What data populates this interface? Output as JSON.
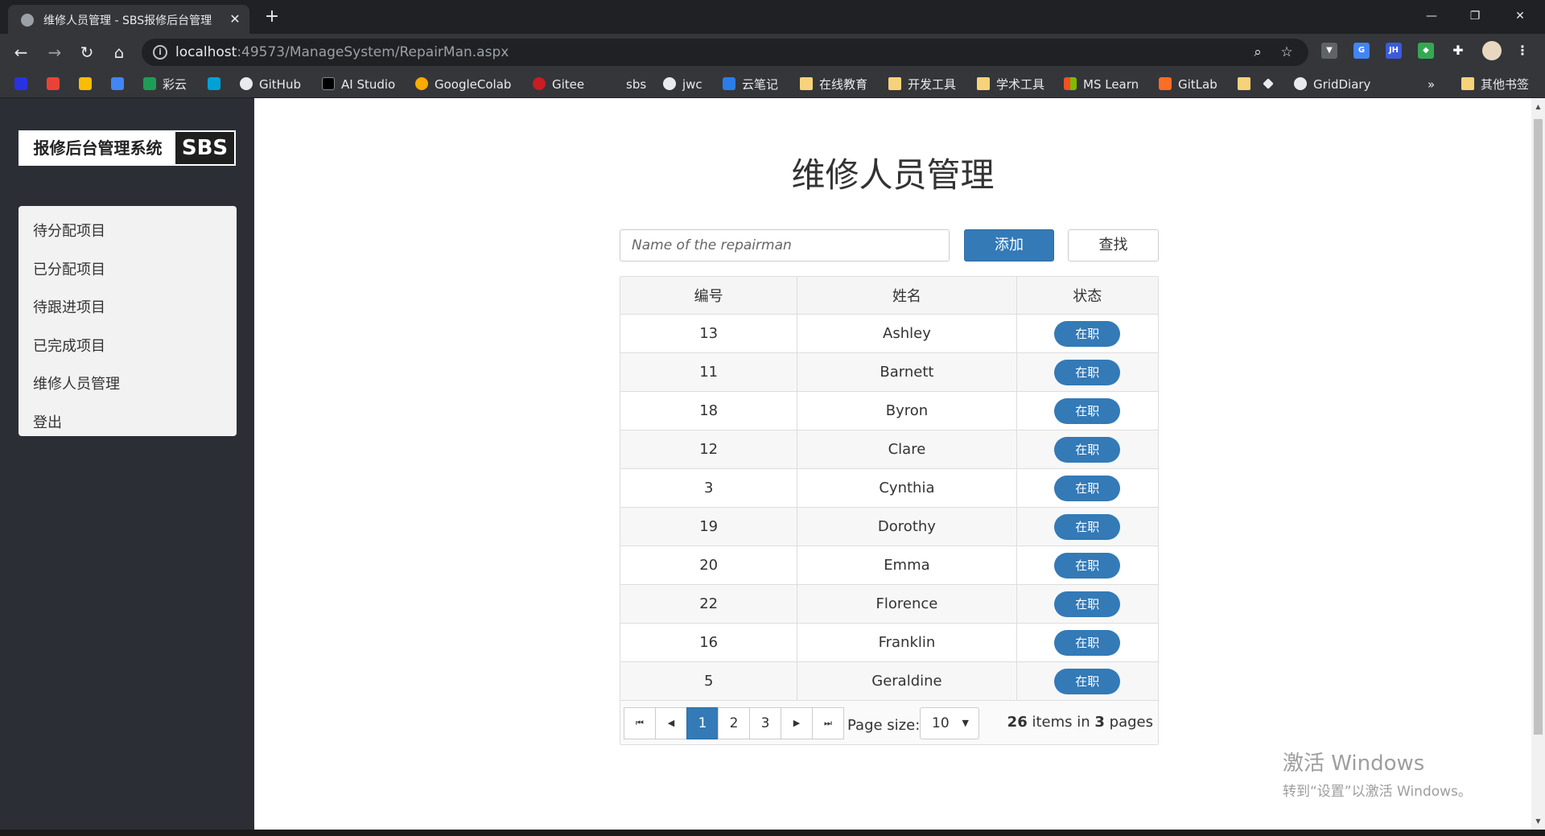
{
  "browser": {
    "tab_title": "维修人员管理 - SBS报修后台管理",
    "tab_close": "✕",
    "new_tab": "+",
    "url_host": "localhost",
    "url_path": ":49573/ManageSystem/RepairMan.aspx",
    "window_controls": {
      "minimize": "—",
      "restore": "❐",
      "close": "✕"
    },
    "bookmarks": [
      {
        "label": "彩云",
        "color": "#1e9d57"
      },
      {
        "label": "GitHub",
        "color": "#e8eaed"
      },
      {
        "label": "AI Studio",
        "color": "#000000"
      },
      {
        "label": "GoogleColab",
        "color": "#f9ab00"
      },
      {
        "label": "Gitee",
        "color": "#c71d23"
      },
      {
        "label": "sbs",
        "color": "#35363a"
      },
      {
        "label": "jwc",
        "color": "#e8eaed"
      },
      {
        "label": "云笔记",
        "color": "#2b7de9"
      },
      {
        "label": "在线教育",
        "color": "#f6d37a"
      },
      {
        "label": "开发工具",
        "color": "#f6d37a"
      },
      {
        "label": "学术工具",
        "color": "#f6d37a"
      },
      {
        "label": "MS Learn",
        "color": "#f25022"
      },
      {
        "label": "GitLab",
        "color": "#fc6d26"
      },
      {
        "label": "GridDiary",
        "color": "#e8eaed"
      },
      {
        "label": "其他书签",
        "color": "#f6d37a"
      }
    ],
    "more_bookmarks": "»"
  },
  "sidebar": {
    "logo_text": "报修后台管理系统",
    "logo_badge": "SBS",
    "menu": [
      "待分配项目",
      "已分配项目",
      "待跟进项目",
      "已完成项目",
      "维修人员管理",
      "登出"
    ]
  },
  "main": {
    "title": "维修人员管理",
    "search_placeholder": "Name of the repairman",
    "add_label": "添加",
    "find_label": "查找",
    "columns": [
      "编号",
      "姓名",
      "状态"
    ],
    "rows": [
      {
        "id": "13",
        "name": "Ashley",
        "status": "在职"
      },
      {
        "id": "11",
        "name": "Barnett",
        "status": "在职"
      },
      {
        "id": "18",
        "name": "Byron",
        "status": "在职"
      },
      {
        "id": "12",
        "name": "Clare",
        "status": "在职"
      },
      {
        "id": "3",
        "name": "Cynthia",
        "status": "在职"
      },
      {
        "id": "19",
        "name": "Dorothy",
        "status": "在职"
      },
      {
        "id": "20",
        "name": "Emma",
        "status": "在职"
      },
      {
        "id": "22",
        "name": "Florence",
        "status": "在职"
      },
      {
        "id": "16",
        "name": "Franklin",
        "status": "在职"
      },
      {
        "id": "5",
        "name": "Geraldine",
        "status": "在职"
      }
    ],
    "pager": {
      "first": "⏮",
      "prev": "◀",
      "pages": [
        "1",
        "2",
        "3"
      ],
      "current_page": "1",
      "next": "▶",
      "last": "⏭",
      "page_size_label": "Page size:",
      "page_size": "10",
      "total_items": "26",
      "items_in_text": "items in",
      "total_pages": "3",
      "pages_text": "pages"
    }
  },
  "watermark": {
    "line1": "激活 Windows",
    "line2": "转到“设置”以激活 Windows。"
  },
  "colors": {
    "primary": "#337ab7",
    "sidebar_bg": "#2b2e35",
    "chrome_bg": "#35363a"
  }
}
